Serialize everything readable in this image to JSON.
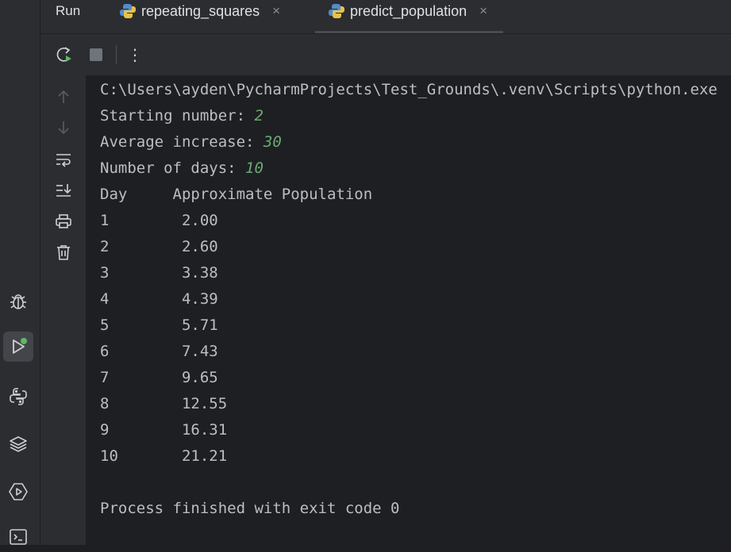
{
  "run_panel": {
    "title": "Run",
    "tabs": [
      {
        "label": "repeating_squares",
        "icon": "python-file-icon"
      },
      {
        "label": "predict_population",
        "icon": "python-file-icon"
      }
    ],
    "close_glyph": "×",
    "more_glyph": "⋮"
  },
  "left_sidebar": {
    "icons": [
      "debug-icon",
      "run-icon",
      "python-console-icon",
      "python-packages-icon",
      "services-icon",
      "terminal-icon"
    ],
    "active": "run-icon"
  },
  "console": {
    "command": "C:\\Users\\ayden\\PycharmProjects\\Test_Grounds\\.venv\\Scripts\\python.exe",
    "prompts": [
      {
        "label": "Starting number: ",
        "value": "2"
      },
      {
        "label": "Average increase: ",
        "value": "30"
      },
      {
        "label": "Number of days: ",
        "value": "10"
      }
    ],
    "table_header": "Day     Approximate Population",
    "rows": [
      "1        2.00",
      "2        2.60",
      "3        3.38",
      "4        4.39",
      "5        5.71",
      "6        7.43",
      "7        9.65",
      "8        12.55",
      "9        16.31",
      "10       21.21"
    ],
    "finish_message": "Process finished with exit code 0"
  },
  "colors": {
    "background": "#1e1f22",
    "panel": "#2b2d30",
    "text": "#bcbec4",
    "user_input": "#6aab73",
    "run_green": "#5fb865"
  }
}
